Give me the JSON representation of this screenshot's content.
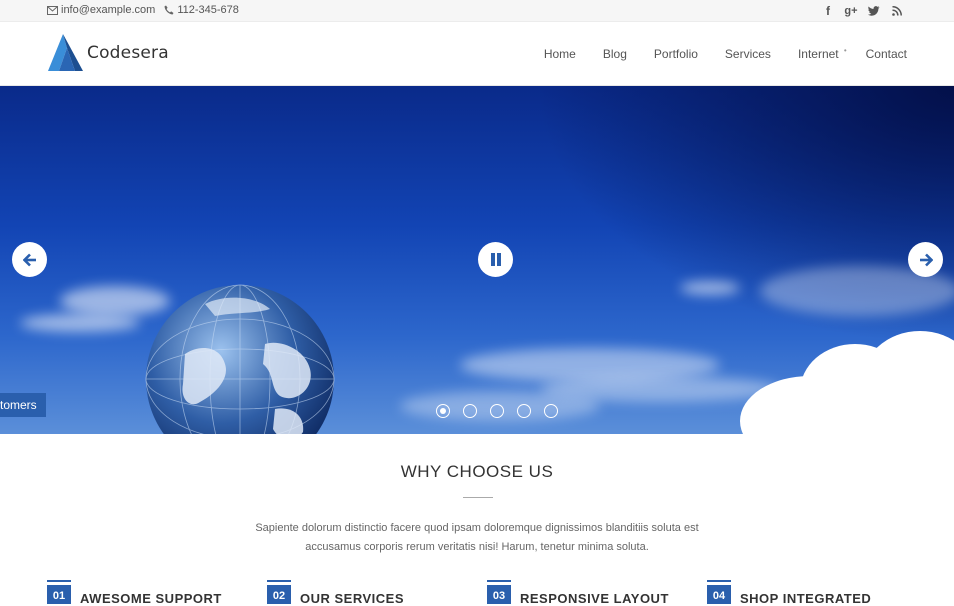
{
  "topbar": {
    "email": "info@example.com",
    "phone": "112-345-678",
    "social": [
      "facebook-icon",
      "google-plus-icon",
      "twitter-icon",
      "rss-icon"
    ]
  },
  "header": {
    "logo_text": "Codesera",
    "nav": [
      {
        "label": "Home"
      },
      {
        "label": "Blog"
      },
      {
        "label": "Portfolio"
      },
      {
        "label": "Services"
      },
      {
        "label": "Internet"
      },
      {
        "label": "Contact"
      }
    ]
  },
  "hero": {
    "caption": "tomers",
    "slides_total": 5,
    "active_slide": 1
  },
  "why": {
    "title": "WHY CHOOSE US",
    "text": "Sapiente dolorum distinctio facere quod ipsam doloremque dignissimos blanditiis soluta est accusamus corporis rerum veritatis nisi! Harum, tenetur minima soluta.",
    "features": [
      {
        "num": "01",
        "title": "AWESOME SUPPORT"
      },
      {
        "num": "02",
        "title": "OUR SERVICES"
      },
      {
        "num": "03",
        "title": "RESPONSIVE LAYOUT"
      },
      {
        "num": "04",
        "title": "SHOP INTEGRATED"
      }
    ]
  },
  "colors": {
    "accent": "#2a5fad",
    "topbar_bg": "#f6f6f6",
    "sky_dark": "#0a2a8a"
  }
}
